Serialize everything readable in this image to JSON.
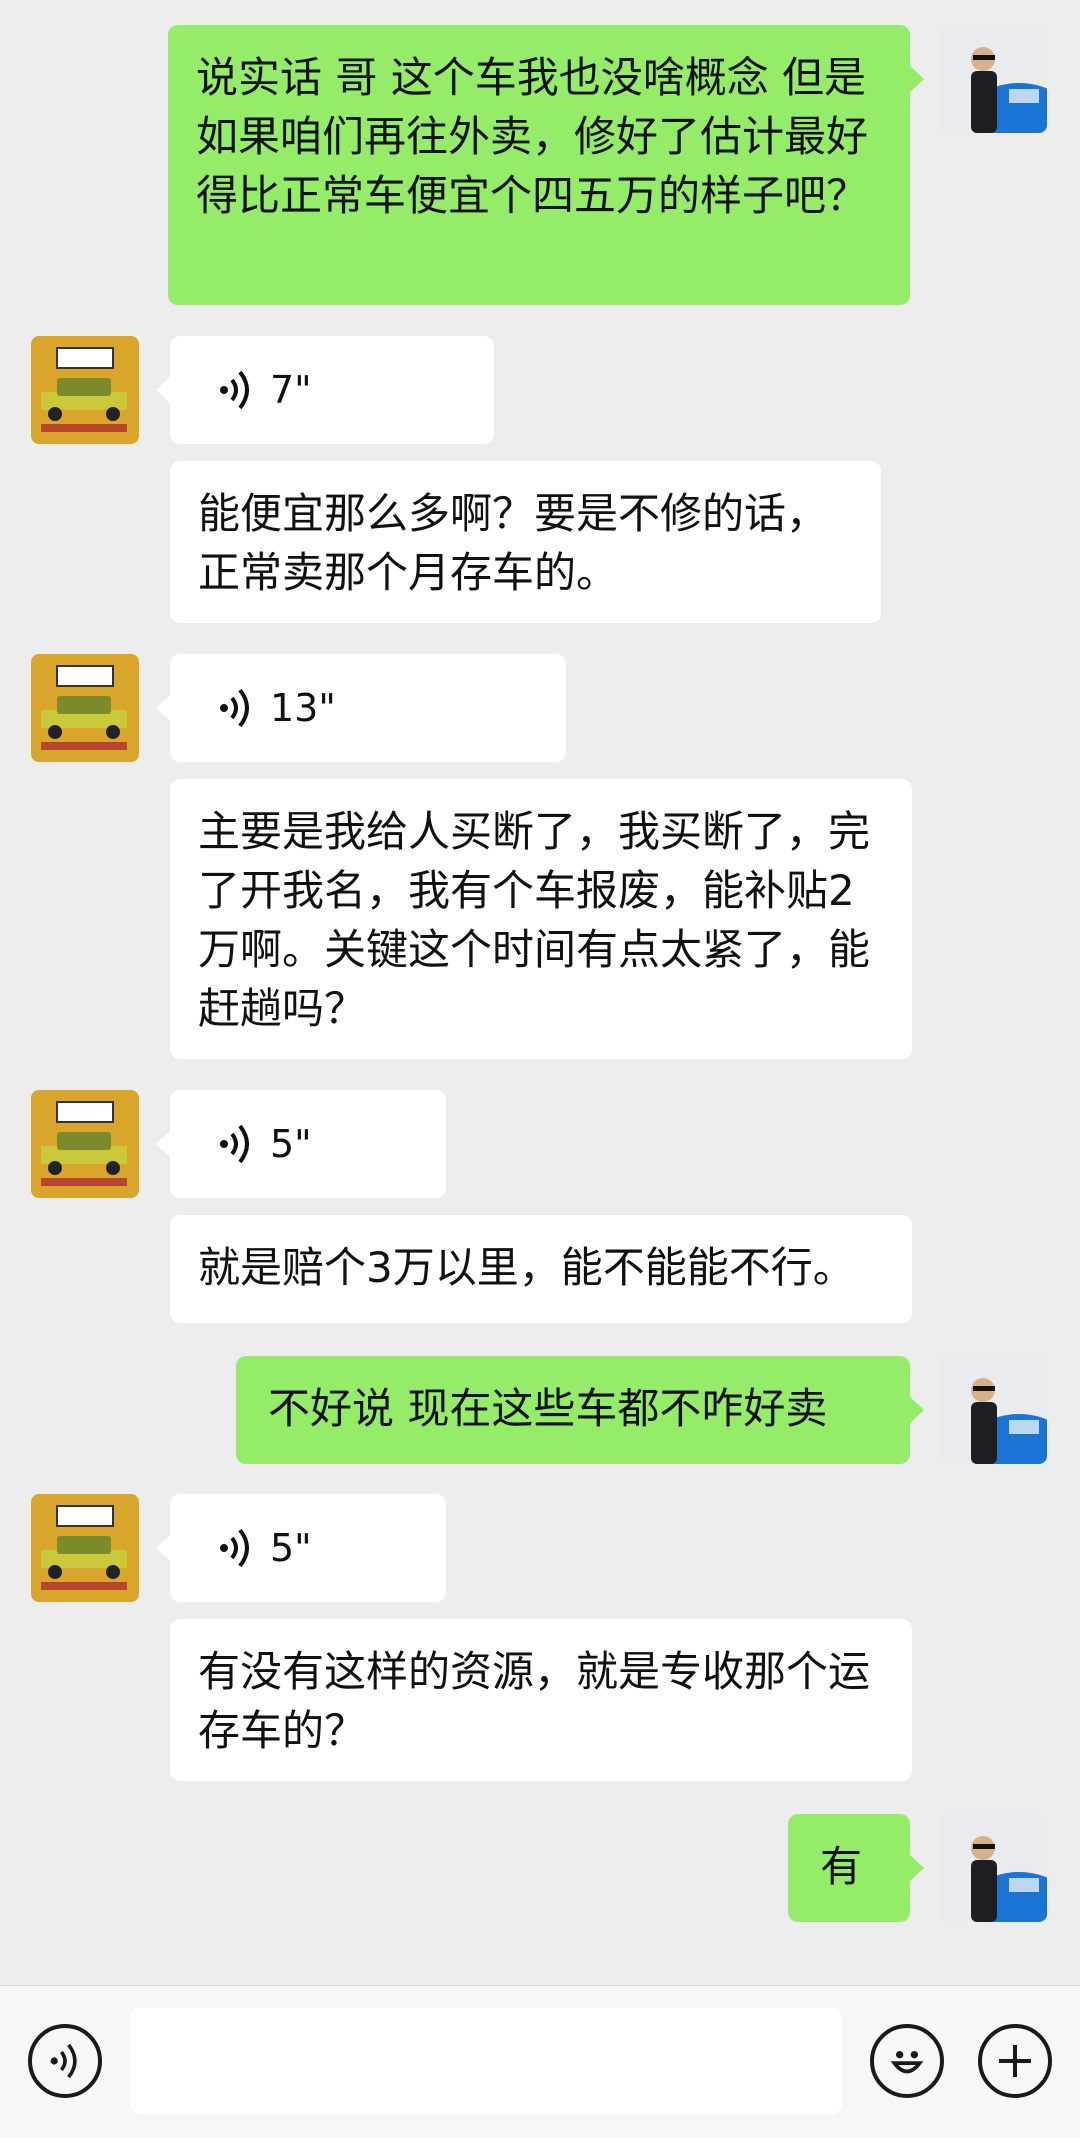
{
  "messages": [
    {
      "from": "me",
      "type": "text",
      "text": "说实话 哥 这个车我也没啥概念  但是如果咱们再往外卖，修好了估计最好得比正常车便宜个四五万的样子吧？"
    },
    {
      "from": "them",
      "type": "voice",
      "duration": "7\""
    },
    {
      "from": "them",
      "type": "text",
      "text": "能便宜那么多啊？要是不修的话，正常卖那个月存车的。"
    },
    {
      "from": "them",
      "type": "voice",
      "duration": "13\""
    },
    {
      "from": "them",
      "type": "text",
      "text": "主要是我给人买断了，我买断了，完了开我名，我有个车报废，能补贴2万啊。关键这个时间有点太紧了，能赶趟吗？"
    },
    {
      "from": "them",
      "type": "voice",
      "duration": "5\""
    },
    {
      "from": "them",
      "type": "text",
      "text": "就是赔个3万以里，能不能能不行。"
    },
    {
      "from": "me",
      "type": "text",
      "text": "不好说 现在这些车都不咋好卖"
    },
    {
      "from": "them",
      "type": "voice",
      "duration": "5\""
    },
    {
      "from": "them",
      "type": "text",
      "text": "有没有这样的资源，就是专收那个运存车的？"
    },
    {
      "from": "me",
      "type": "text",
      "text": "有"
    }
  ],
  "input_bar": {
    "voice_icon": "voice-input-icon",
    "emoji_icon": "emoji-icon",
    "plus_icon": "plus-icon",
    "input_value": ""
  },
  "colors": {
    "background": "#ededed",
    "my_bubble": "#95ec69",
    "their_bubble": "#ffffff"
  }
}
